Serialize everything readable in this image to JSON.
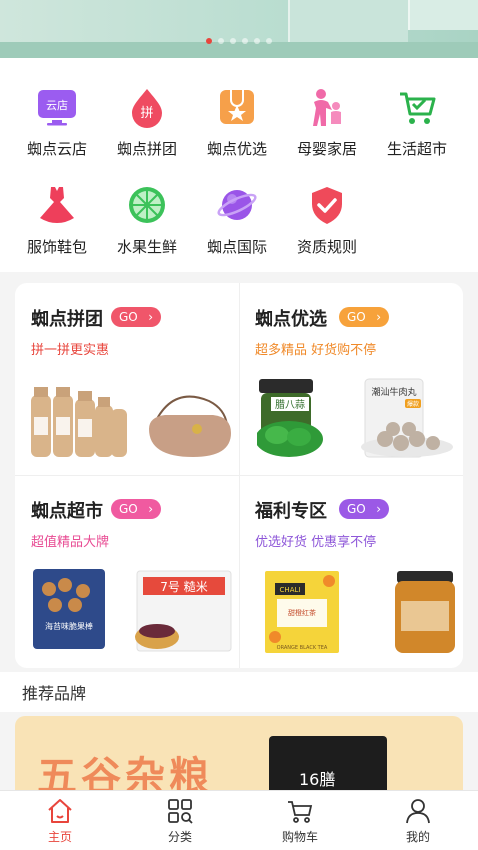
{
  "banner": {
    "slide_count": 6,
    "active_slide": 1
  },
  "categories": [
    {
      "label": "蜘点云店",
      "icon": "cloud-store-icon",
      "icon_text": "云店"
    },
    {
      "label": "蜘点拼团",
      "icon": "group-buy-icon",
      "icon_text": "拼"
    },
    {
      "label": "蜘点优选",
      "icon": "preferred-icon",
      "icon_text": ""
    },
    {
      "label": "母婴家居",
      "icon": "mother-baby-icon",
      "icon_text": ""
    },
    {
      "label": "生活超市",
      "icon": "supermarket-cart-icon",
      "icon_text": ""
    },
    {
      "label": "服饰鞋包",
      "icon": "dress-icon",
      "icon_text": ""
    },
    {
      "label": "水果生鲜",
      "icon": "fruit-icon",
      "icon_text": ""
    },
    {
      "label": "蜘点国际",
      "icon": "planet-icon",
      "icon_text": ""
    },
    {
      "label": "资质规则",
      "icon": "shield-check-icon",
      "icon_text": ""
    }
  ],
  "promos": [
    {
      "title": "蜘点拼团",
      "go": "GO",
      "subtitle": "拼一拼更实惠",
      "go_color": "#f0566a",
      "sub_color": "#e8453c"
    },
    {
      "title": "蜘点优选",
      "go": "GO",
      "subtitle": "超多精品 好货购不停",
      "go_color": "#f7a23b",
      "sub_color": "#f08a2a"
    },
    {
      "title": "蜘点超市",
      "go": "GO",
      "subtitle": "超值精品大牌",
      "go_color": "#f05aa0",
      "sub_color": "#e84b93"
    },
    {
      "title": "福利专区",
      "go": "GO",
      "subtitle": "优选好货 优惠享不停",
      "go_color": "#9b59e6",
      "sub_color": "#8e57d9"
    }
  ],
  "product_text": {
    "pickle_jar": "腊八蒜",
    "meatball_bag": "潮汕牛肉丸",
    "meatball_badge": "爆款",
    "snack_bag": "海苔味脆果棒",
    "rice_bag": "7号 糙米",
    "tea_box_brand": "CHALI",
    "tea_box_name": "甜橙红茶",
    "tea_box_en": "ORANGE BLACK TEA"
  },
  "brand_section": {
    "title": "推荐品牌",
    "banner_text": "五谷杂粮",
    "bag_text": "16膳"
  },
  "tabbar": [
    {
      "label": "主页",
      "icon": "home-icon",
      "active": true
    },
    {
      "label": "分类",
      "icon": "category-icon",
      "active": false
    },
    {
      "label": "购物车",
      "icon": "cart-icon",
      "active": false
    },
    {
      "label": "我的",
      "icon": "profile-icon",
      "active": false
    }
  ],
  "colors": {
    "accent": "#e8453c",
    "background": "#f4f4f4",
    "card": "#ffffff"
  }
}
